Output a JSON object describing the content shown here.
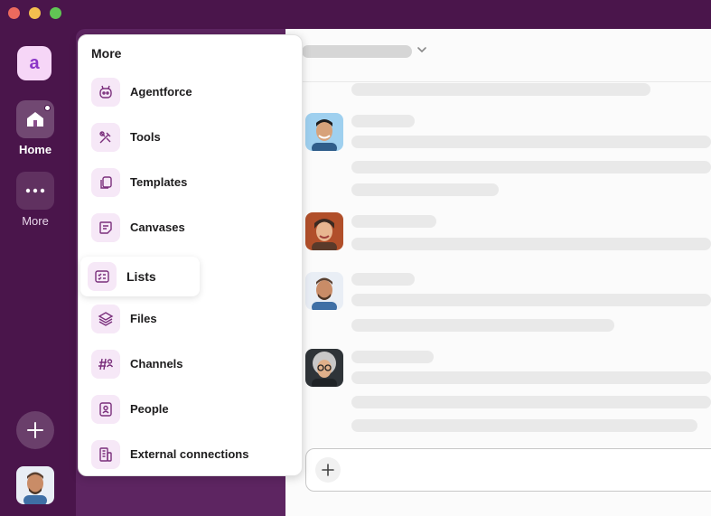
{
  "rail": {
    "workspace_initial": "a",
    "home_label": "Home",
    "more_label": "More"
  },
  "menu": {
    "title": "More",
    "items": [
      {
        "label": "Agentforce",
        "icon": "agent-icon"
      },
      {
        "label": "Tools",
        "icon": "tools-icon"
      },
      {
        "label": "Templates",
        "icon": "templates-icon"
      },
      {
        "label": "Canvases",
        "icon": "canvas-icon"
      },
      {
        "label": "Lists",
        "icon": "lists-icon"
      },
      {
        "label": "Files",
        "icon": "files-icon"
      },
      {
        "label": "Channels",
        "icon": "channels-icon"
      },
      {
        "label": "People",
        "icon": "people-icon"
      },
      {
        "label": "External connections",
        "icon": "building-icon"
      }
    ]
  },
  "colors": {
    "aubergine": "#4a154b",
    "sidebar": "#5d2561",
    "icon_bg": "#f6e8f7",
    "icon_stroke": "#7a2f7c"
  }
}
